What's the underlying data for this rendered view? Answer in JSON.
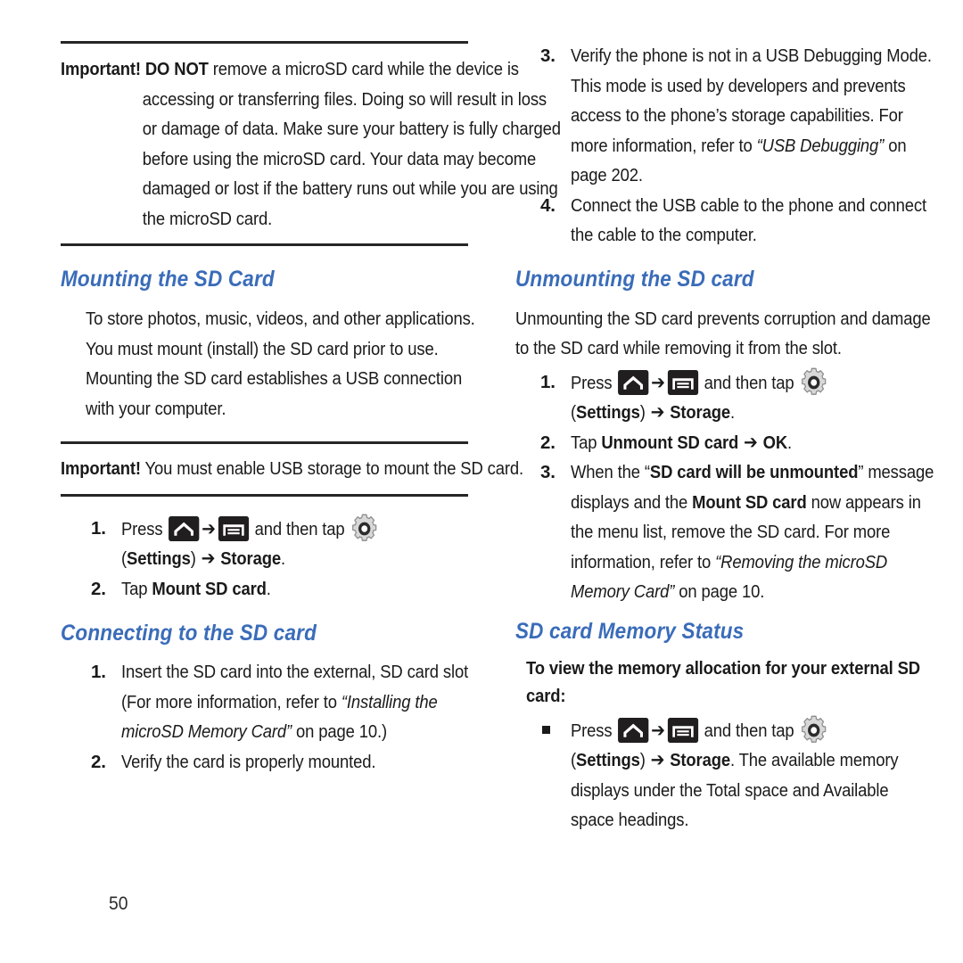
{
  "page": {
    "number": "50",
    "accent_color": "#3a6cb9",
    "text_color": "#1a1a1a",
    "rule_color": "#262626"
  },
  "icons": {
    "home": "home-icon",
    "menu": "menu-icon",
    "gear": "settings-gear-icon",
    "arrow": "➔",
    "bullet": "square-bullet-icon"
  },
  "left_column": {
    "important_note_1": {
      "label": "Important!",
      "text_lead": "DO NOT",
      "text_body": " remove a microSD card while the device is accessing or transferring files. Doing so will result in loss or damage of data. Make sure your battery is fully charged before using the microSD card. Your data may become damaged or lost if the battery runs out while you are using the microSD card."
    },
    "heading_mounting": "Mounting the SD Card",
    "paragraph_mounting": "To store photos, music, videos, and other applications. You must mount (install) the SD card prior to use. Mounting the SD card establishes a USB connection with your computer.",
    "important_note_2": {
      "label": "Important!",
      "text_body": " You must enable USB storage to mount the SD card."
    },
    "steps_mounting": [
      {
        "marker": "1.",
        "part_a": "Press ",
        "part_b": " and then tap ",
        "part_c_paren_open": "(",
        "part_c_bold": "Settings",
        "part_c_paren_close": ")",
        "part_d_bold": "Storage",
        "part_d_end": "."
      },
      {
        "marker": "2.",
        "part_a": "Tap ",
        "bold": "Mount SD card",
        "part_b": "."
      }
    ],
    "heading_connecting": "Connecting to the SD card",
    "steps_connecting": [
      {
        "marker": "1.",
        "part_a": "Insert the SD card into the external, SD card slot (For more information, refer to ",
        "italic": "“Installing the microSD Memory Card”",
        "part_b": " on page 10.)"
      },
      {
        "marker": "2.",
        "part_a": "Verify the card is properly mounted."
      }
    ]
  },
  "right_column": {
    "steps_connecting_cont": [
      {
        "marker": "3.",
        "part_a": "Verify the phone is not in a USB Debugging Mode. This mode is used by developers and prevents access to the phone’s storage capabilities. For more information, refer to ",
        "italic": "“USB Debugging”",
        "part_b": " on page 202."
      },
      {
        "marker": "4.",
        "part_a": "Connect the USB cable to the phone and connect the cable to the computer."
      }
    ],
    "heading_unmounting": "Unmounting the SD card",
    "paragraph_unmounting": "Unmounting the SD card prevents corruption and damage to the SD card while removing it from the slot.",
    "steps_unmounting": [
      {
        "marker": "1.",
        "part_a": "Press ",
        "part_b": " and then tap ",
        "part_c_paren_open": "(",
        "part_c_bold": "Settings",
        "part_c_paren_close": ")",
        "part_d_bold": "Storage",
        "part_d_end": "."
      },
      {
        "marker": "2.",
        "part_a": "Tap ",
        "bold_1": "Unmount SD card",
        "bold_2": "OK",
        "part_b": "."
      },
      {
        "marker": "3.",
        "part_a": "When the “",
        "bold_1": "SD card will be unmounted",
        "part_b": "” message displays and the ",
        "bold_2": "Mount SD card",
        "part_c": " now appears in the menu list, remove the SD card. For more information, refer to ",
        "italic": "“Removing the microSD Memory Card”",
        "part_d": " on page 10."
      }
    ],
    "heading_memory_status": "SD card Memory Status",
    "memory_status_intro": "To view the memory allocation for your external SD card:",
    "memory_status_step": {
      "marker": "■",
      "part_a": "Press ",
      "part_b": " and then tap ",
      "part_c_paren_open": "(",
      "part_c_bold": "Settings",
      "part_c_paren_close": ")",
      "part_d_bold": "Storage",
      "part_d_end": ". The available memory displays under the Total space and Available space headings."
    }
  }
}
